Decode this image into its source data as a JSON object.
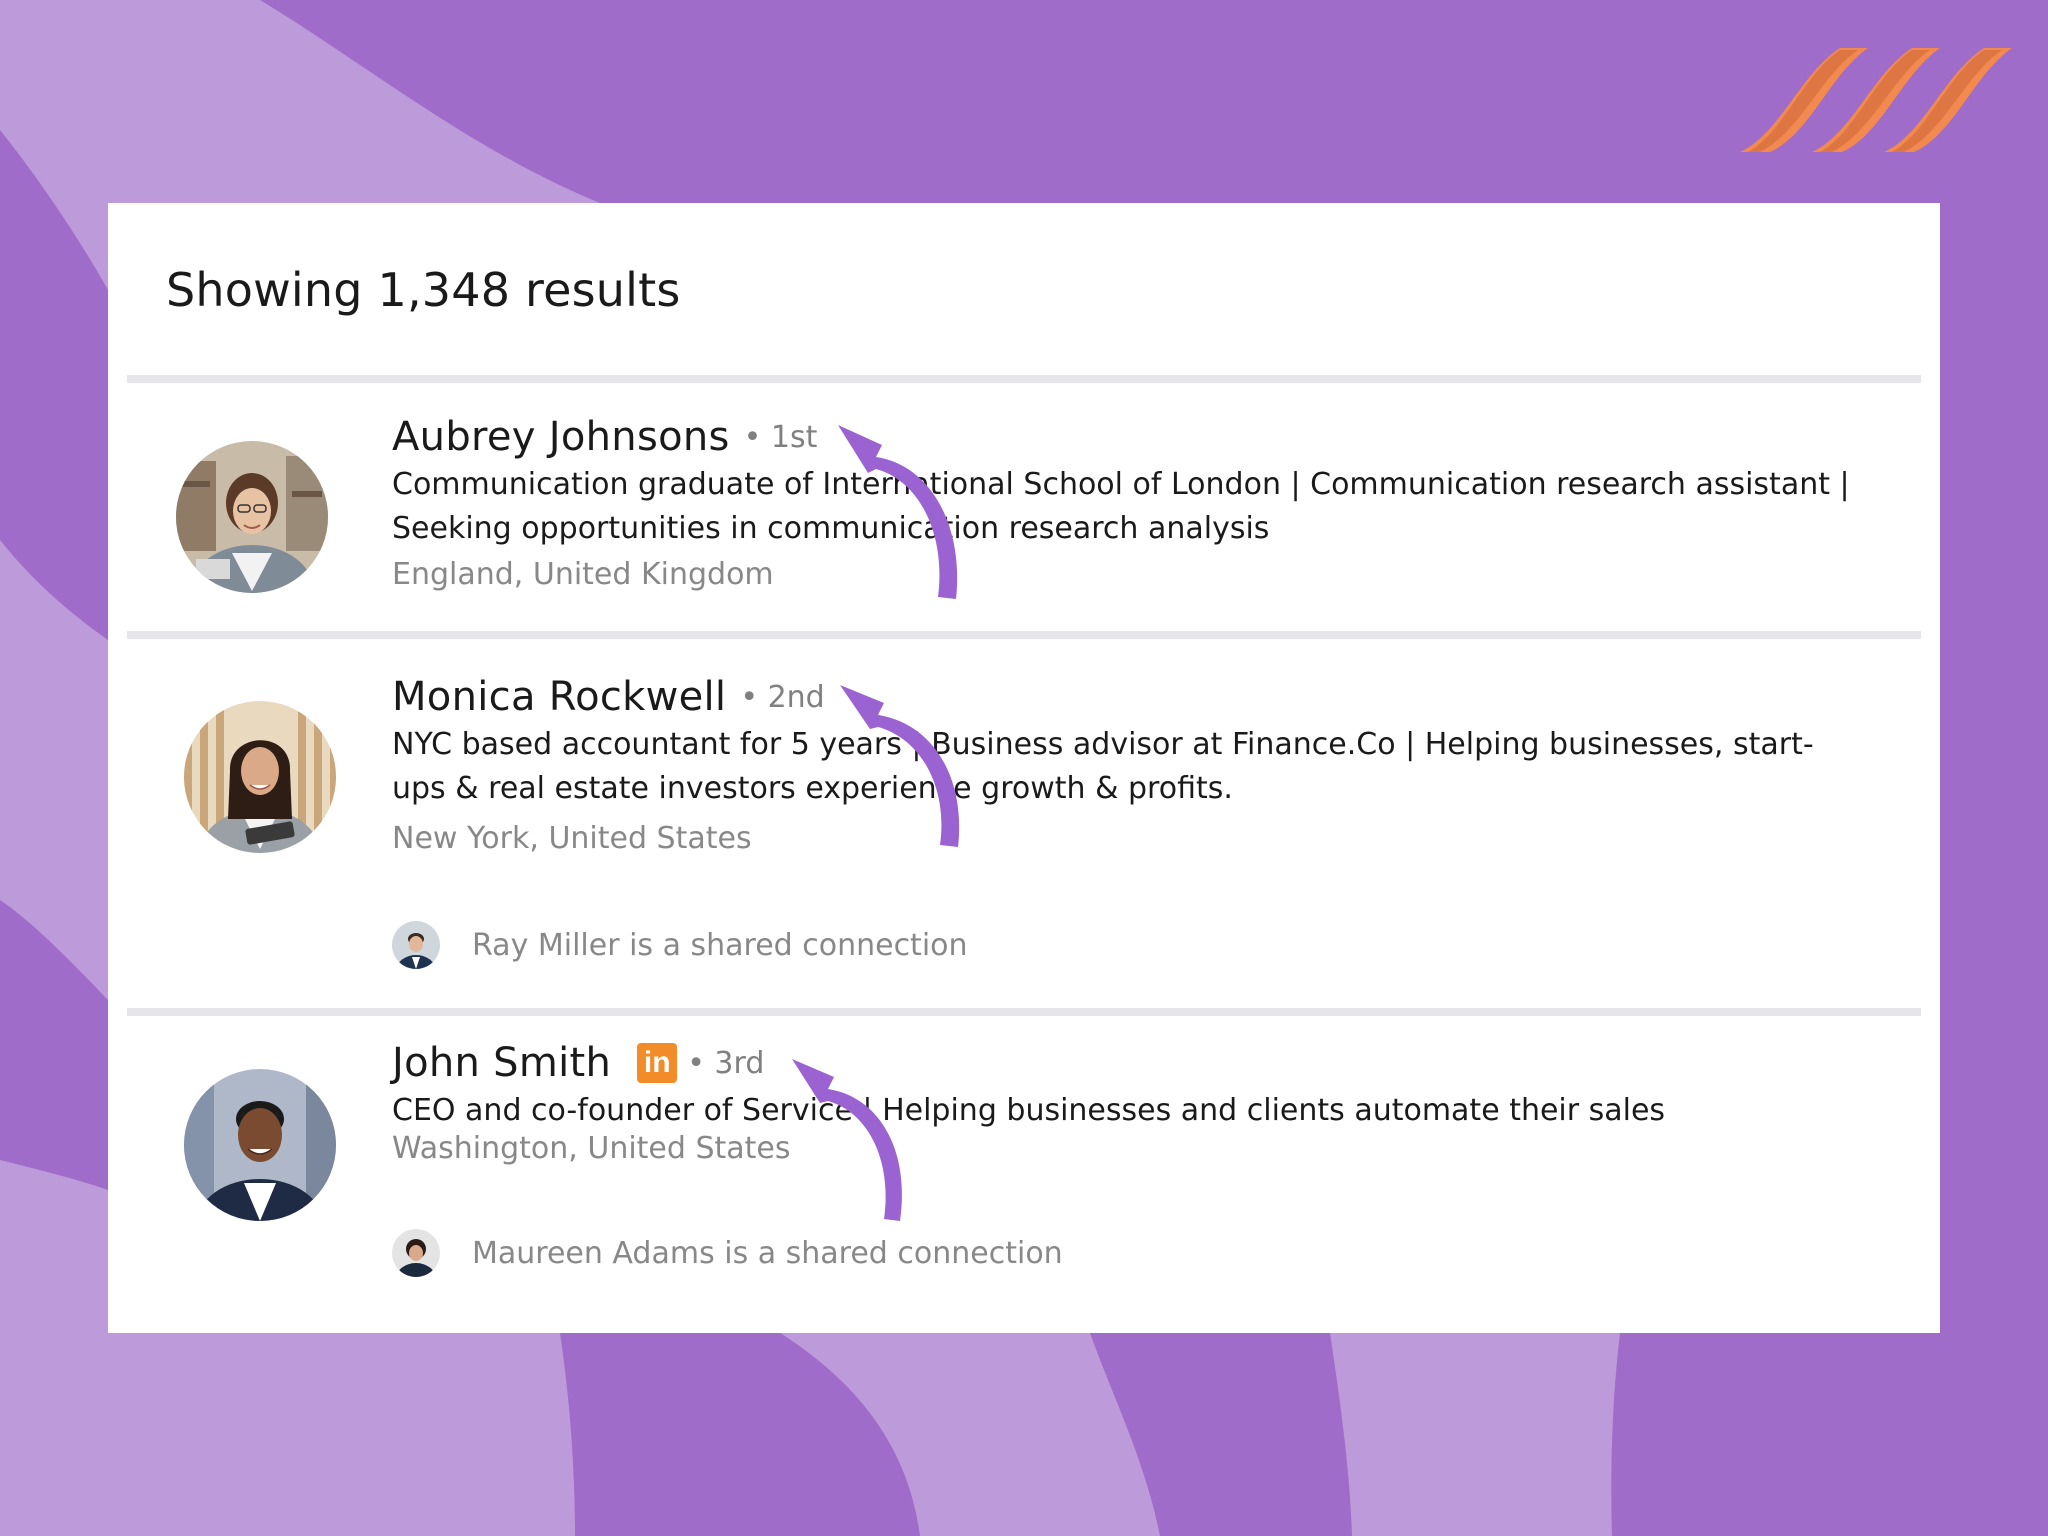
{
  "header": {
    "results_title": "Showing 1,348 results"
  },
  "results": [
    {
      "name": "Aubrey Johnsons",
      "degree": "• 1st",
      "headline": "Communication graduate of International School of London | Communication research assistant | Seeking opportunities in communication research analysis",
      "location": "England, United Kingdom"
    },
    {
      "name": "Monica Rockwell",
      "degree": "• 2nd",
      "headline": "NYC based accountant for 5 years | Business advisor at Finance.Co | Helping businesses, start-ups & real estate investors experience growth & profits.",
      "location": "New York, United States",
      "shared_connection": "Ray Miller is a shared connection"
    },
    {
      "name": "John Smith",
      "badge": "in",
      "degree": "• 3rd",
      "headline": "CEO and co-founder of Service | Helping businesses and clients automate their sales",
      "location": "Washington, United States",
      "shared_connection": "Maureen Adams is a shared connection"
    }
  ],
  "colors": {
    "background": "#9f6cc9",
    "background_light": "#bd9ad9",
    "arrow": "#9b63d1",
    "logo": "#f28a4f",
    "linkedin_badge": "#f28c28"
  },
  "icons": {
    "brand_logo": "three-slanted-stripes-logo",
    "annotation": "curved-arrow-icon",
    "network_badge": "linkedin-icon"
  }
}
